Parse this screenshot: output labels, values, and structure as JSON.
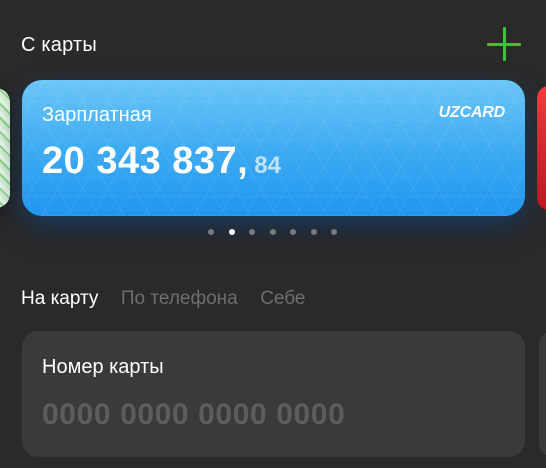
{
  "header": {
    "title": "С карты",
    "add_icon": "plus-icon",
    "accent_color": "#3fc13a"
  },
  "card": {
    "name": "Зарплатная",
    "brand": "UZCARD",
    "balance_main": "20 343 837,",
    "balance_cents": "84",
    "gradient_colors": [
      "#6cc6f6",
      "#2196ef"
    ]
  },
  "pagination": {
    "count": 7,
    "active_index": 1
  },
  "tabs": [
    {
      "label": "На карту",
      "active": true
    },
    {
      "label": "По телефона",
      "active": false
    },
    {
      "label": "Себе",
      "active": false
    }
  ],
  "card_input": {
    "label": "Номер карты",
    "placeholder": "0000 0000 0000 0000",
    "value": ""
  }
}
